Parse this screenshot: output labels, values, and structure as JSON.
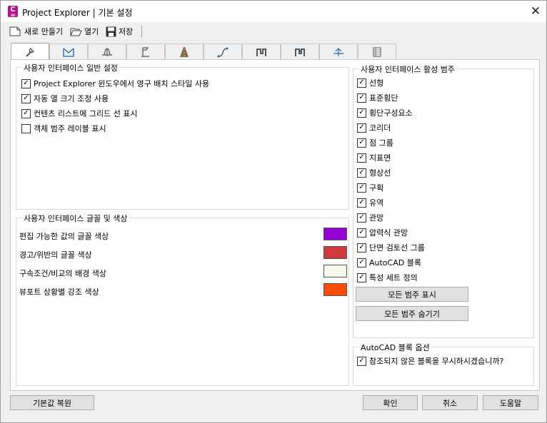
{
  "window": {
    "title": "Project Explorer | 기본 설정",
    "icon_letter": "C",
    "icon_sub": "3D",
    "close_glyph": "✕"
  },
  "toolbar": {
    "new_label": "새로 만들기",
    "open_label": "열기",
    "save_label": "저장"
  },
  "tabs": [
    {
      "icon": "wrench-icon"
    },
    {
      "icon": "surface-icon"
    },
    {
      "icon": "section-icon"
    },
    {
      "icon": "flag-icon"
    },
    {
      "icon": "road-icon"
    },
    {
      "icon": "alignment-icon"
    },
    {
      "icon": "pipe-network-icon"
    },
    {
      "icon": "pressure-network-icon"
    },
    {
      "icon": "profile-icon"
    },
    {
      "icon": "table-icon"
    }
  ],
  "general": {
    "title": "사용자 인터페이스 일반 설정",
    "options": [
      {
        "label": "Project Explorer 윈도우에서 영구 배치 스타일 사용",
        "checked": true
      },
      {
        "label": "자동 열 크기 조정 사용",
        "checked": true
      },
      {
        "label": "컨텐츠 리스트에 그리드 선 표시",
        "checked": true
      },
      {
        "label": "객체 범주 레이블 표시",
        "checked": false
      }
    ]
  },
  "fonts_colors": {
    "title": "사용자 인터페이스 글꼴 및 색상",
    "rows": [
      {
        "label": "편집 가능한 값의 글꼴 색상",
        "color": "#9400d3"
      },
      {
        "label": "경고/위반의 글꼴 색상",
        "color": "#d03a3a"
      },
      {
        "label": "구속조건/비교의 배경 색상",
        "color": "#f8f8ee"
      },
      {
        "label": "뷰포트 상황별 강조 색상",
        "color": "#ff4d00"
      }
    ]
  },
  "categories": {
    "title": "사용자 인터페이스 활성 범주",
    "items": [
      {
        "label": "선형",
        "checked": true
      },
      {
        "label": "표준횡단",
        "checked": true
      },
      {
        "label": "횡단구성요소",
        "checked": true
      },
      {
        "label": "코리더",
        "checked": true
      },
      {
        "label": "점 그룹",
        "checked": true
      },
      {
        "label": "지표면",
        "checked": true
      },
      {
        "label": "형상선",
        "checked": true
      },
      {
        "label": "구획",
        "checked": true
      },
      {
        "label": "유역",
        "checked": true
      },
      {
        "label": "관망",
        "checked": true
      },
      {
        "label": "압력식 관망",
        "checked": true
      },
      {
        "label": "단면 검토선 그룹",
        "checked": true
      },
      {
        "label": "AutoCAD 블록",
        "checked": true
      },
      {
        "label": "특성 세트 정의",
        "checked": true
      }
    ],
    "show_all_label": "모든 범주 표시",
    "hide_all_label": "모든 범주 숨기기"
  },
  "block_options": {
    "title": "AutoCAD 블록 옵션",
    "ignore_label": "참조되지 않은 블록을 무시하시겠습니까?",
    "ignore_checked": true
  },
  "footer": {
    "restore_label": "기본값 복원",
    "ok_label": "확인",
    "cancel_label": "취소",
    "help_label": "도움말"
  }
}
